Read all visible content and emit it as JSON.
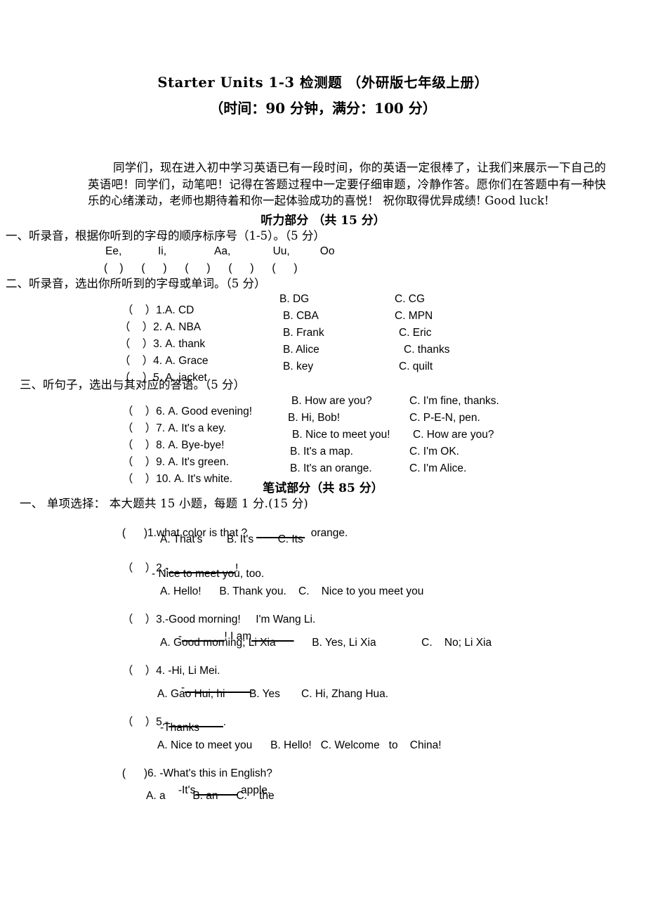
{
  "document": {
    "title": "Starter Units 1-3 检测题 （外研版七年级上册）",
    "subtitle": "（时间：90 分钟，满分：100 分）",
    "intro": "同学们，现在进入初中学习英语已有一段时间，你的英语一定很棒了，让我们来展示一下自己的英语吧！同学们，动笔吧！记得在答题过程中一定要仔细审题，冷静作答。愿你们在答题中有一种快乐的心绪漾动，老师也期待着和你一起体验成功的喜悦！ 祝你取得优异成绩! Good luck!"
  },
  "listening_section": {
    "header": "听力部分 （共 15 分）",
    "part1": {
      "instruction": "一、听录音，根据你听到的字母的顺序标序号（1-5）。（5 分）",
      "letters": "Ee,            Ii,                Aa,              Uu,          Oo",
      "blanks": "(    )      (      )      (      )      (      )      (      )"
    },
    "part2": {
      "instruction": "二、听录音，选出你所听到的字母或单词。（5 分）",
      "items": [
        {
          "box": "（    ）",
          "num": "1.",
          "a": "A. CD",
          "b": "B. DG",
          "c": "C. CG"
        },
        {
          "box": "（    ）",
          "num": "2. ",
          "a": "A. NBA",
          "b": "B. CBA",
          "c": "C. MPN"
        },
        {
          "box": "（    ）",
          "num": "3. ",
          "a": "A. thank",
          "b": "B. Frank",
          "c": "C. Eric"
        },
        {
          "box": "（    ）",
          "num": "4. ",
          "a": "A. Grace",
          "b": "B. Alice",
          "c": "C. thanks"
        },
        {
          "box": "（    ）",
          "num": "5. ",
          "a": "A. jacket",
          "b": "B. key",
          "c": "C. quilt"
        }
      ]
    },
    "part3": {
      "instruction": "三、听句子，选出与其对应的答语。（5 分）",
      "items": [
        {
          "box": "（    ）",
          "num": "6. ",
          "a": "A. Good evening!",
          "b": "B. How are you?",
          "c": "C. I'm fine, thanks."
        },
        {
          "box": "（    ）",
          "num": "7. ",
          "a": "A. It's a key.",
          "b": "B. Hi, Bob!",
          "c": "C. P-E-N, pen."
        },
        {
          "box": "（    ）",
          "num": "8. ",
          "a": "A. Bye-bye!",
          "b": "B. Nice to meet you!",
          "c": "C. How are you?"
        },
        {
          "box": "（    ）",
          "num": "9. ",
          "a": "A. It's green.",
          "b": "B. It's a map.",
          "c": "C. I'm OK."
        },
        {
          "box": "（    ）",
          "num": "10. ",
          "a": "A. It's white.",
          "b": "B. It's an orange.",
          "c": "C. I'm Alice."
        }
      ]
    }
  },
  "written_section": {
    "header": "笔试部分（共 85 分）",
    "part1_instruction": "一、    单项选择：  本大题共 15 小题，每题 1 分.(15 分)",
    "questions": [
      {
        "box": "(      )",
        "stem": "1.what color is that ?",
        "blank": "________",
        "stem_tail": "orange.",
        "options": "A. That's        B. It's        C. Its"
      },
      {
        "box": "（    ）",
        "stem_num": "2.-",
        "blank": "___________",
        "stem_tail": "!",
        "reply": "- Nice to meet you, too.",
        "options": "A. Hello!      B. Thank you.    C.    Nice to you meet you"
      },
      {
        "box": "（    ）",
        "stem": "3.-Good morning!     I'm Wang Li.",
        "reply_pre": "-",
        "reply_blank1": "_______",
        "reply_mid": "! I am",
        "reply_blank2": "_______",
        "options": "A. Good morning; Li Xia            B. Yes, Li Xia               C.    No; Li Xia"
      },
      {
        "box": "（    ）",
        "stem": "4. -Hi, Li Mei.",
        "reply_pre": "-",
        "reply_blank1": "___________",
        "reply_mid": ".",
        "options": "A. Gao Hui, hi        B. Yes       C. Hi, Zhang Hua."
      },
      {
        "box": "（    ）",
        "stem_num": "5.-",
        "blank": "_________",
        "stem_tail": ".",
        "reply": "-Thanks",
        "options": "A. Nice to meet you      B. Hello!   C. Welcome   to    China!"
      },
      {
        "box": "(      )",
        "stem": "6. -What's this in English?",
        "reply_pre": "-It's",
        "reply_blank1": "_______",
        "reply_mid": " apple.",
        "options": "A. a         B. an      C.    the"
      }
    ]
  }
}
